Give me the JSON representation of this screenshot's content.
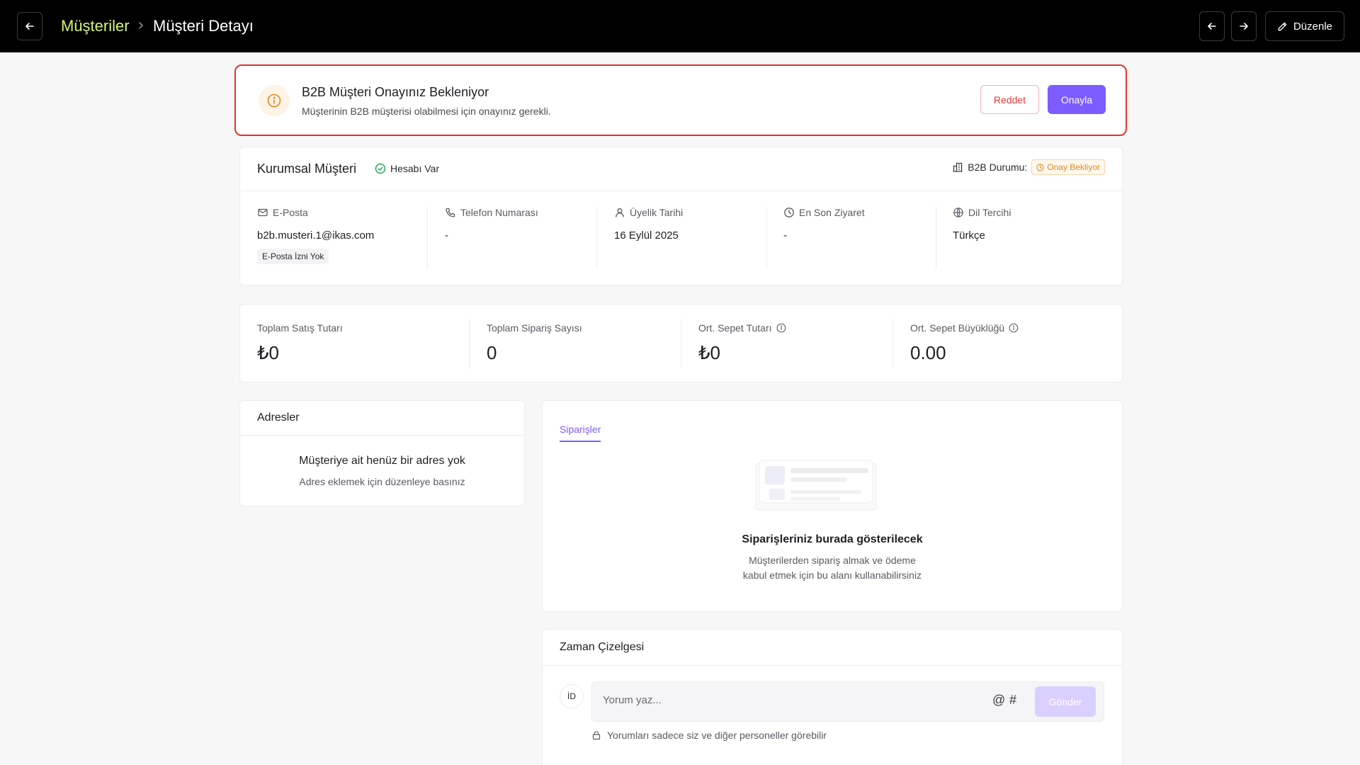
{
  "header": {
    "breadcrumb_parent": "Müşteriler",
    "breadcrumb_current": "Müşteri Detayı",
    "edit_label": "Düzenle"
  },
  "alert": {
    "title": "B2B Müşteri Onayınız Bekleniyor",
    "description": "Müşterinin B2B müşterisi olabilmesi için onayınız gerekli.",
    "reject_label": "Reddet",
    "approve_label": "Onayla"
  },
  "customer": {
    "name": "Kurumsal Müşteri",
    "account_badge": "Hesabı Var",
    "b2b_status_label": "B2B Durumu:",
    "b2b_status_value": "Onay Bekliyor",
    "email_label": "E-Posta",
    "email_value": "b2b.musteri.1@ikas.com",
    "email_tag": "E-Posta İzni Yok",
    "phone_label": "Telefon Numarası",
    "phone_value": "-",
    "member_since_label": "Üyelik Tarihi",
    "member_since_value": "16 Eylül 2025",
    "last_visit_label": "En Son Ziyaret",
    "last_visit_value": "-",
    "language_label": "Dil Tercihi",
    "language_value": "Türkçe"
  },
  "stats": [
    {
      "label": "Toplam Satış Tutarı",
      "value": "₺0"
    },
    {
      "label": "Toplam Sipariş Sayısı",
      "value": "0"
    },
    {
      "label": "Ort. Sepet Tutarı",
      "value": "₺0"
    },
    {
      "label": "Ort. Sepet Büyüklüğü",
      "value": "0.00"
    }
  ],
  "addresses": {
    "title": "Adresler",
    "empty_title": "Müşteriye ait henüz bir adres yok",
    "empty_subtitle": "Adres eklemek için düzenleye basınız"
  },
  "orders": {
    "tab_label": "Siparişler",
    "empty_title": "Siparişleriniz burada gösterilecek",
    "empty_line1": "Müşterilerden sipariş almak ve ödeme",
    "empty_line2": "kabul etmek için bu alanı kullanabilirsiniz"
  },
  "timeline": {
    "title": "Zaman Çizelgesi",
    "avatar_initials": "İD",
    "comment_placeholder": "Yorum yaz...",
    "mention_symbol": "@",
    "tag_symbol": "#",
    "send_label": "Gönder",
    "privacy_note": "Yorumları sadece siz ve diğer personeller görebilir"
  },
  "colors": {
    "accent": "#7c5cff",
    "breadcrumb_link": "#d8f56e",
    "alert_border": "#e0332e",
    "warning": "#e38a1a",
    "success": "#22a55b",
    "danger": "#e33b3b"
  }
}
